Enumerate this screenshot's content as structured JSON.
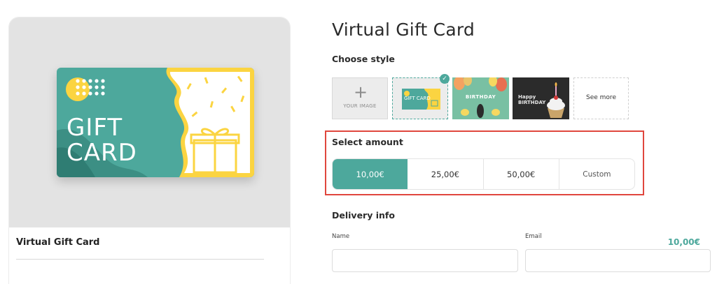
{
  "preview": {
    "card_text_line1": "GIFT",
    "card_text_line2": "CARD",
    "colors": {
      "teal": "#4da89c",
      "yellow": "#fbd441",
      "panel_bg": "#e3e3e3"
    }
  },
  "summary": {
    "product_name": "Virtual Gift Card",
    "price": "10,00€"
  },
  "form": {
    "title": "Virtual Gift Card",
    "choose_style_label": "Choose style",
    "style_options": {
      "upload_label": "YOUR IMAGE",
      "gift_text": "GIFT CARD",
      "birthday_text": "BIRTHDAY",
      "cake_text_line1": "Happy",
      "cake_text_line2": "BIRTHDAY",
      "see_more": "See more"
    },
    "select_amount_label": "Select amount",
    "amounts": [
      "10,00€",
      "25,00€",
      "50,00€",
      "Custom"
    ],
    "selected_amount": "10,00€",
    "delivery_label": "Delivery info",
    "name_label": "Name",
    "email_label": "Email",
    "name_value": "",
    "email_value": ""
  },
  "icons": {
    "check": "check-icon",
    "plus": "plus-icon"
  },
  "accent_color": "#4da89c",
  "highlight_color": "#e0463d"
}
